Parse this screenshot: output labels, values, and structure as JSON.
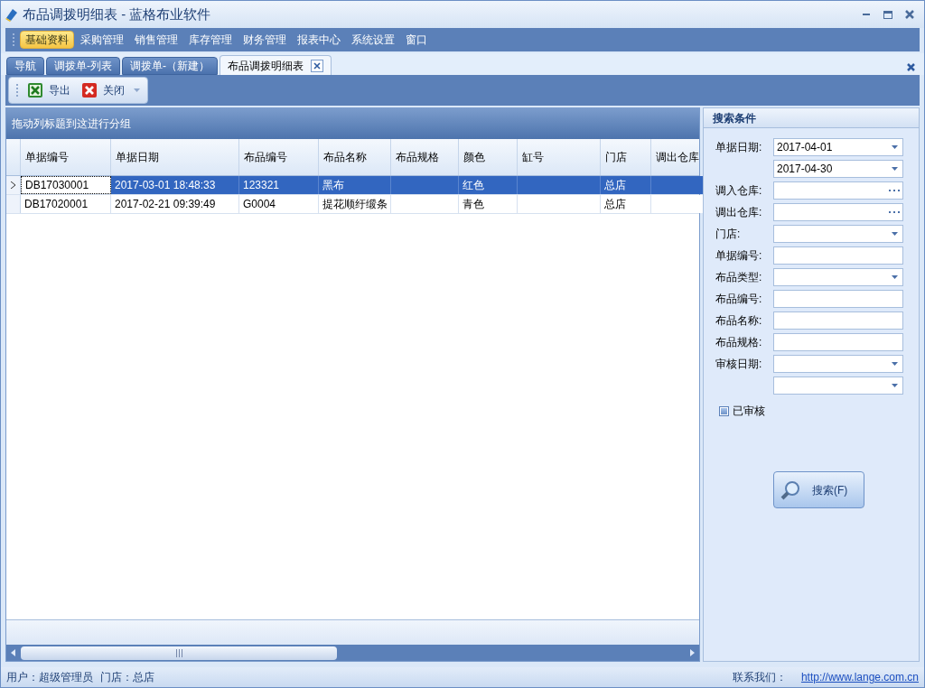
{
  "window": {
    "title": "布品调拨明细表 - 蓝格布业软件"
  },
  "menu": [
    {
      "label": "基础资料",
      "selected": true
    },
    {
      "label": "采购管理",
      "selected": false
    },
    {
      "label": "销售管理",
      "selected": false
    },
    {
      "label": "库存管理",
      "selected": false
    },
    {
      "label": "财务管理",
      "selected": false
    },
    {
      "label": "报表中心",
      "selected": false
    },
    {
      "label": "系统设置",
      "selected": false
    },
    {
      "label": "窗口",
      "selected": false
    }
  ],
  "tabs": [
    {
      "label": "导航",
      "selected": false
    },
    {
      "label": "调拨单-列表",
      "selected": false
    },
    {
      "label": "调拨单-（新建）",
      "selected": false
    },
    {
      "label": "布品调拨明细表",
      "selected": true
    }
  ],
  "toolbar": [
    {
      "label": "导出",
      "kind": "export"
    },
    {
      "label": "关闭",
      "kind": "close"
    }
  ],
  "grid": {
    "group_hint": "拖动列标题到这进行分组",
    "columns": [
      "单据编号",
      "单据日期",
      "布品编号",
      "布品名称",
      "布品规格",
      "颜色",
      "缸号",
      "门店",
      "调出仓库"
    ],
    "rows": [
      {
        "selected": true,
        "focused": true,
        "cells": [
          "DB17030001",
          "2017-03-01 18:48:33",
          "123321",
          "黑布",
          "",
          "红色",
          "",
          "总店",
          ""
        ]
      },
      {
        "selected": false,
        "focused": false,
        "cells": [
          "DB17020001",
          "2017-02-21 09:39:49",
          "G0004",
          "提花顺纡缎条",
          "",
          "青色",
          "",
          "总店",
          ""
        ]
      }
    ]
  },
  "search_panel": {
    "title": "搜索条件",
    "fields": [
      {
        "label": "单据日期:",
        "value": "2017-04-01",
        "kind": "dropdown"
      },
      {
        "value": "2017-04-30",
        "kind": "dropdown"
      },
      {
        "label": "调入仓库:",
        "kind": "picker"
      },
      {
        "label": "调出仓库:",
        "kind": "picker"
      },
      {
        "label": "门店:",
        "kind": "dropdown"
      },
      {
        "label": "单据编号:",
        "kind": "text"
      },
      {
        "label": "布品类型:",
        "kind": "dropdown"
      },
      {
        "label": "布品编号:",
        "kind": "text"
      },
      {
        "label": "布品名称:",
        "kind": "text"
      },
      {
        "label": "布品规格:",
        "kind": "text"
      },
      {
        "label": "审核日期:",
        "kind": "dropdown"
      },
      {
        "kind": "dropdown"
      }
    ],
    "checkbox": {
      "label": "已审核",
      "checked": false
    },
    "button": "搜索(F)"
  },
  "status_bar": {
    "user": "用户：超级管理员",
    "store": "门店：总店",
    "contact": "联系我们：",
    "link": "http://www.lange.com.cn"
  }
}
